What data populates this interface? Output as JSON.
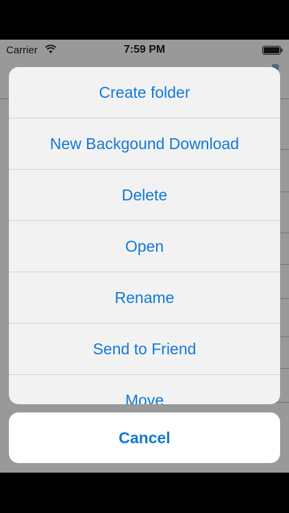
{
  "status_bar": {
    "carrier": "Carrier",
    "time": "7:59 PM"
  },
  "action_sheet": {
    "items": [
      {
        "label": "Create folder"
      },
      {
        "label": "New Backgound Download"
      },
      {
        "label": "Delete"
      },
      {
        "label": "Open"
      },
      {
        "label": "Rename"
      },
      {
        "label": "Send to Friend"
      },
      {
        "label": "Move"
      }
    ],
    "cancel_label": "Cancel"
  },
  "colors": {
    "accent": "#1378d6",
    "sheet_background": "#f2f2f3",
    "dim_overlay": "rgba(0,0,0,0.40)"
  },
  "icons": [
    "wifi-icon",
    "battery-icon"
  ]
}
